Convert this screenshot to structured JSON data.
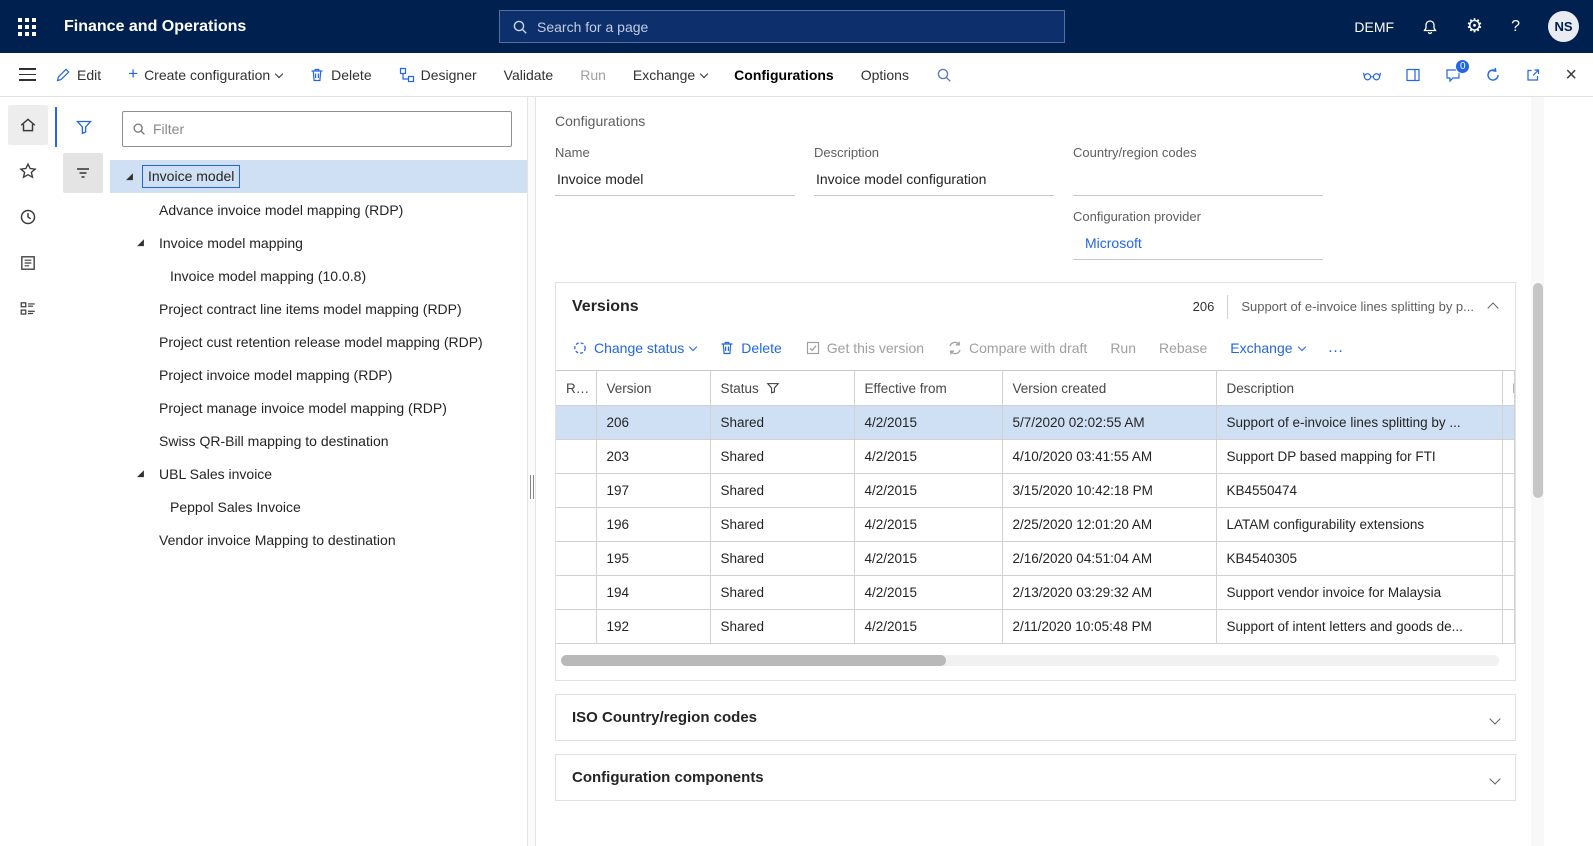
{
  "icons": {
    "gear": "⚙",
    "question": "?",
    "close": "×",
    "ellipsis": "…",
    "plus": "+",
    "expand_triangle": "◢"
  },
  "topbar": {
    "app_title": "Finance and Operations",
    "search_placeholder": "Search for a page",
    "company": "DEMF",
    "avatar_initials": "NS"
  },
  "actionbar": {
    "edit": "Edit",
    "create_configuration": "Create configuration",
    "delete": "Delete",
    "designer": "Designer",
    "validate": "Validate",
    "run": "Run",
    "exchange": "Exchange",
    "configurations": "Configurations",
    "options": "Options",
    "message_badge": "0"
  },
  "tree": {
    "filter_placeholder": "Filter",
    "items": [
      {
        "label": "Invoice model",
        "level": 0,
        "expanded": true,
        "selected": true
      },
      {
        "label": "Advance invoice model mapping (RDP)",
        "level": 1
      },
      {
        "label": "Invoice model mapping",
        "level": 1,
        "expanded": true
      },
      {
        "label": "Invoice model mapping (10.0.8)",
        "level": 2
      },
      {
        "label": "Project contract line items model mapping (RDP)",
        "level": 1
      },
      {
        "label": "Project cust retention release model mapping (RDP)",
        "level": 1
      },
      {
        "label": "Project invoice model mapping (RDP)",
        "level": 1
      },
      {
        "label": "Project manage invoice model mapping (RDP)",
        "level": 1
      },
      {
        "label": "Swiss QR-Bill mapping to destination",
        "level": 1
      },
      {
        "label": "UBL Sales invoice",
        "level": 1,
        "expanded": true
      },
      {
        "label": "Peppol Sales Invoice",
        "level": 2
      },
      {
        "label": "Vendor invoice Mapping to destination",
        "level": 1
      }
    ]
  },
  "details": {
    "section_label": "Configurations",
    "name_label": "Name",
    "name_value": "Invoice model",
    "description_label": "Description",
    "description_value": "Invoice model configuration",
    "country_label": "Country/region codes",
    "country_value": "",
    "provider_label": "Configuration provider",
    "provider_value": "Microsoft"
  },
  "versions": {
    "title": "Versions",
    "count": "206",
    "summary": "Support of e-invoice lines splitting by p...",
    "toolbar": {
      "change_status": "Change status",
      "delete": "Delete",
      "get_this_version": "Get this version",
      "compare_with_draft": "Compare with draft",
      "run": "Run",
      "rebase": "Rebase",
      "exchange": "Exchange"
    },
    "table": {
      "columns": [
        "R...",
        "Version",
        "Status",
        "Effective from",
        "Version created",
        "Description",
        "B..."
      ],
      "rows": [
        {
          "version": "206",
          "status": "Shared",
          "effective_from": "4/2/2015",
          "created": "5/7/2020 02:02:55 AM",
          "description": "Support of e-invoice lines splitting by ...",
          "selected": true
        },
        {
          "version": "203",
          "status": "Shared",
          "effective_from": "4/2/2015",
          "created": "4/10/2020 03:41:55 AM",
          "description": "Support DP based mapping for FTI"
        },
        {
          "version": "197",
          "status": "Shared",
          "effective_from": "4/2/2015",
          "created": "3/15/2020 10:42:18 PM",
          "description": "KB4550474"
        },
        {
          "version": "196",
          "status": "Shared",
          "effective_from": "4/2/2015",
          "created": "2/25/2020 12:01:20 AM",
          "description": "LATAM configurability extensions"
        },
        {
          "version": "195",
          "status": "Shared",
          "effective_from": "4/2/2015",
          "created": "2/16/2020 04:51:04 AM",
          "description": "KB4540305"
        },
        {
          "version": "194",
          "status": "Shared",
          "effective_from": "4/2/2015",
          "created": "2/13/2020 03:29:32 AM",
          "description": "Support vendor invoice for Malaysia"
        },
        {
          "version": "192",
          "status": "Shared",
          "effective_from": "4/2/2015",
          "created": "2/11/2020 10:05:48 PM",
          "description": "Support of intent letters and goods de..."
        }
      ]
    }
  },
  "sections": {
    "iso": "ISO Country/region codes",
    "components": "Configuration components"
  }
}
